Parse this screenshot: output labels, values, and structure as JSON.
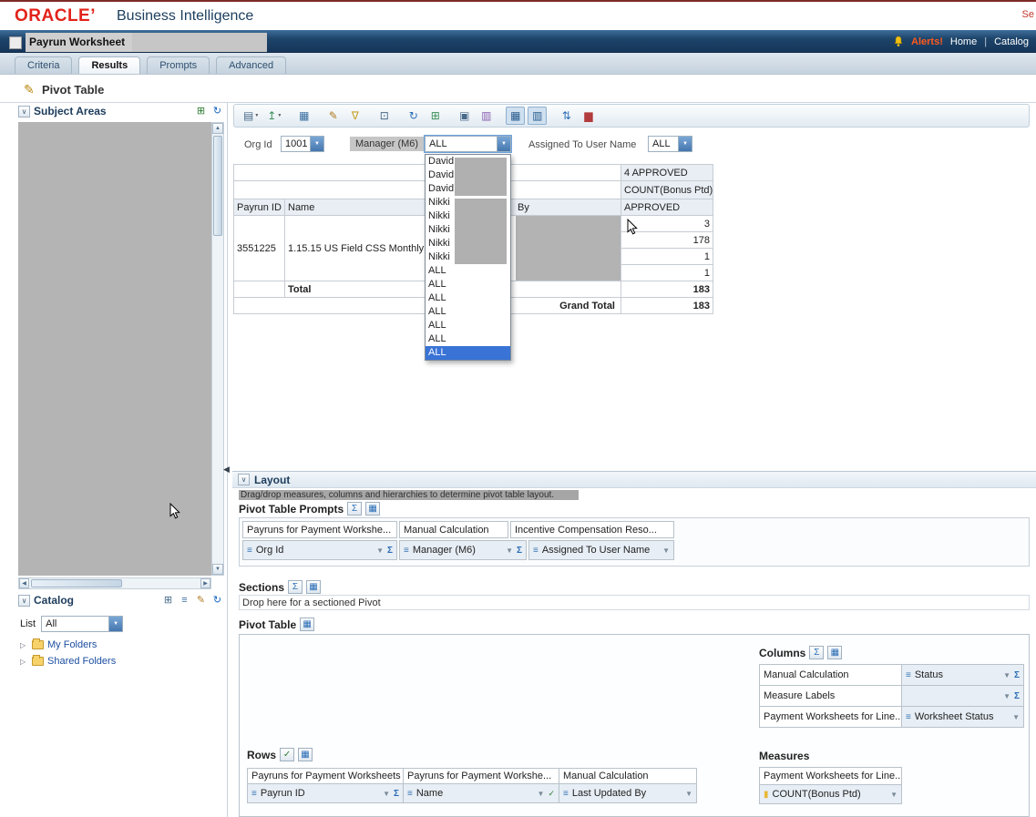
{
  "colors": {
    "brand_red": "#e2231a",
    "header_navy": "#16365a",
    "selection_blue": "#3973d6",
    "alert_orange": "#ff5a1e",
    "redaction_gray": "#b3b3b3"
  },
  "icons": {
    "caret": "▼",
    "chevron_down": "∨",
    "pencil": "✎",
    "sigma": "Σ",
    "grid": "▦",
    "funnel": "▼",
    "field": "≡",
    "tree_expand": "▷",
    "scroll_up": "▲",
    "scroll_down": "▼",
    "scroll_left": "◀",
    "scroll_right": "▶",
    "collapse_left": "◀",
    "green_check": "✓",
    "measure": "▮",
    "refresh": "↻",
    "expand_all": "⊞",
    "edit": "✎",
    "list": "≡"
  },
  "brand": {
    "logo": "ORACLE’",
    "product": "Business Intelligence",
    "search_partial": "Se"
  },
  "titlebar": {
    "title": "Payrun Worksheet",
    "alerts": "Alerts!",
    "home": "Home",
    "separator": "|",
    "catalog": "Catalog"
  },
  "tabs": [
    {
      "name": "tab-criteria",
      "label": "Criteria"
    },
    {
      "name": "tab-results",
      "label": "Results",
      "selected": true
    },
    {
      "name": "tab-prompts",
      "label": "Prompts"
    },
    {
      "name": "tab-advanced",
      "label": "Advanced"
    }
  ],
  "view": {
    "title": "Pivot Table"
  },
  "subject_areas": {
    "title": "Subject Areas"
  },
  "catalog_panel": {
    "title": "Catalog",
    "list_label": "List",
    "list_value": "All",
    "folders": [
      {
        "name": "folder-my-folders",
        "label": "My Folders"
      },
      {
        "name": "folder-shared-folders",
        "label": "Shared Folders"
      }
    ]
  },
  "toolbar": {
    "buttons": [
      {
        "name": "print-button",
        "glyph": "▤",
        "caret": true,
        "color": "#4a6b8a"
      },
      {
        "name": "export-button",
        "glyph": "↥",
        "caret": true,
        "color": "#3b8f5a"
      },
      {
        "name": "show-results-button",
        "glyph": "▦",
        "gap": true,
        "color": "#3b6fa0"
      },
      {
        "name": "formatting-button",
        "glyph": "✎",
        "gap": true,
        "color": "#b07a1e"
      },
      {
        "name": "filter-button",
        "glyph": "∇",
        "color": "#c9a227"
      },
      {
        "name": "selection-steps-button",
        "glyph": "⊡",
        "gap": true,
        "color": "#4a6b8a"
      },
      {
        "name": "refresh-button",
        "glyph": "↻",
        "gap": true,
        "color": "#2a6db5"
      },
      {
        "name": "bookmark-button",
        "glyph": "⊞",
        "color": "#3b8f5a"
      },
      {
        "name": "properties-button",
        "glyph": "▣",
        "gap": true,
        "color": "#4a6b8a"
      },
      {
        "name": "freeze-columns-button",
        "glyph": "▥",
        "color": "#8a5fb0"
      },
      {
        "name": "table-view-toggle",
        "glyph": "▦",
        "gap": true,
        "pressed": true,
        "color": "#2a5d8f"
      },
      {
        "name": "pivot-view-toggle",
        "glyph": "▥",
        "pressed": true,
        "color": "#2a5d8f"
      },
      {
        "name": "sort-button",
        "glyph": "⇅",
        "gap": true,
        "color": "#2a6db5"
      },
      {
        "name": "chart-button",
        "glyph": "▆",
        "color": "#b23b3b"
      }
    ]
  },
  "prompts": {
    "org_id": {
      "label": "Org Id",
      "value": "1001"
    },
    "manager": {
      "label": "Manager (M6)",
      "value": "ALL"
    },
    "assigned": {
      "label": "Assigned To User Name",
      "value": "ALL"
    }
  },
  "dropdown": {
    "options": [
      {
        "label": "David"
      },
      {
        "label": "David"
      },
      {
        "label": "David"
      },
      {
        "label": "Nikki"
      },
      {
        "label": "Nikki"
      },
      {
        "label": "Nikki"
      },
      {
        "label": "Nikki"
      },
      {
        "label": "Nikki"
      },
      {
        "label": "ALL"
      },
      {
        "label": "ALL"
      },
      {
        "label": "ALL"
      },
      {
        "label": "ALL"
      },
      {
        "label": "ALL"
      },
      {
        "label": "ALL"
      },
      {
        "label": "ALL",
        "selected": true
      }
    ]
  },
  "pivot": {
    "approved_group_header": "4 APPROVED",
    "measure_header": "COUNT(Bonus Ptd)",
    "columns": {
      "payrun_id": "Payrun ID",
      "name": "Name",
      "by": "By",
      "approved": "APPROVED"
    },
    "row": {
      "payrun_id": "3551225",
      "name": "1.15.15 US Field CSS Monthly Pa",
      "values": [
        "3",
        "178",
        "1",
        "1"
      ]
    },
    "total_label": "Total",
    "total_value": "183",
    "grand_total_label": "Grand Total",
    "grand_total_value": "183"
  },
  "layout": {
    "title": "Layout",
    "hint": "Drag/drop measures, columns and hierarchies to determine pivot table layout.",
    "pivot_table_prompts": {
      "title": "Pivot Table Prompts",
      "groups": [
        {
          "label": "Payruns for Payment Workshe..."
        },
        {
          "label": "Manual Calculation"
        },
        {
          "label": "Incentive Compensation Reso..."
        }
      ],
      "fields": [
        {
          "label": "Org Id"
        },
        {
          "label": "Manager (M6)"
        },
        {
          "label": "Assigned To User Name"
        }
      ]
    },
    "sections": {
      "title": "Sections",
      "hint": "Drop here for a sectioned Pivot"
    },
    "pivot_table_label": "Pivot Table",
    "columns": {
      "title": "Columns",
      "rows": [
        {
          "group": "Manual Calculation",
          "field": "Status"
        },
        {
          "group": "Measure Labels",
          "field": ""
        },
        {
          "group": "Payment Worksheets for Line...",
          "field": "Worksheet Status"
        }
      ]
    },
    "rows": {
      "title": "Rows",
      "groups": [
        {
          "label": "Payruns for Payment Worksheets"
        },
        {
          "label": "Payruns for Payment Workshe..."
        },
        {
          "label": "Manual Calculation"
        }
      ],
      "fields": [
        {
          "label": "Payrun ID"
        },
        {
          "label": "Name"
        },
        {
          "label": "Last Updated By"
        }
      ]
    },
    "measures": {
      "title": "Measures",
      "group": "Payment Worksheets for Line...",
      "field": "COUNT(Bonus Ptd)"
    }
  }
}
